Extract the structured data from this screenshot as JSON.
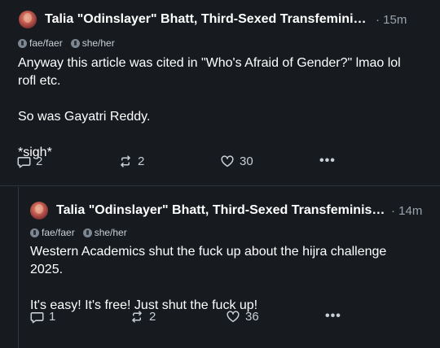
{
  "posts": [
    {
      "author": "Talia \"Odinslayer\" Bhatt, Third-Sexed Transfeminist ♀...",
      "time": "· 15m",
      "pronouns": [
        "fae/faer",
        "she/her"
      ],
      "text": "Anyway this article was cited in \"Who's Afraid of Gender?\" lmao lol rofl etc.\n\nSo was Gayatri Reddy.\n\n*sigh*",
      "replies": "2",
      "reposts": "2",
      "likes": "30",
      "more": "•••"
    },
    {
      "author": "Talia \"Odinslayer\" Bhatt, Third-Sexed Transfeminist...",
      "time": "· 14m",
      "pronouns": [
        "fae/faer",
        "she/her"
      ],
      "text": "Western Academics shut the fuck up about the hijra challenge 2025.\n\nIt's easy! It's free! Just shut the fuck up!",
      "replies": "1",
      "reposts": "2",
      "likes": "36",
      "more": "•••"
    }
  ],
  "colors": {
    "background": "#171b20",
    "text": "#ffffff",
    "muted": "#9aa3ad",
    "icon": "#c7ced6"
  }
}
